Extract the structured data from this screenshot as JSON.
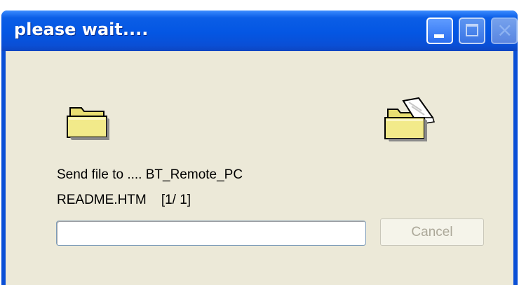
{
  "window": {
    "title": "please wait...."
  },
  "titlebar_buttons": {
    "minimize_icon": "minimize-icon",
    "maximize_icon": "maximize-icon",
    "close_icon": "close-icon"
  },
  "transfer": {
    "source_icon": "folder-icon",
    "destination_icon": "open-folder-with-document-icon",
    "status_text": "Send file to .... BT_Remote_PC",
    "file_line": "README.HTM    [1/ 1]",
    "progress_fraction": 0,
    "cancel_label": "Cancel",
    "cancel_enabled": false
  },
  "colors": {
    "titlebar": "#0a4fd6",
    "client_background": "#ece9d8",
    "folder_yellow": "#f2ea8a",
    "disabled_text": "#aca899"
  }
}
